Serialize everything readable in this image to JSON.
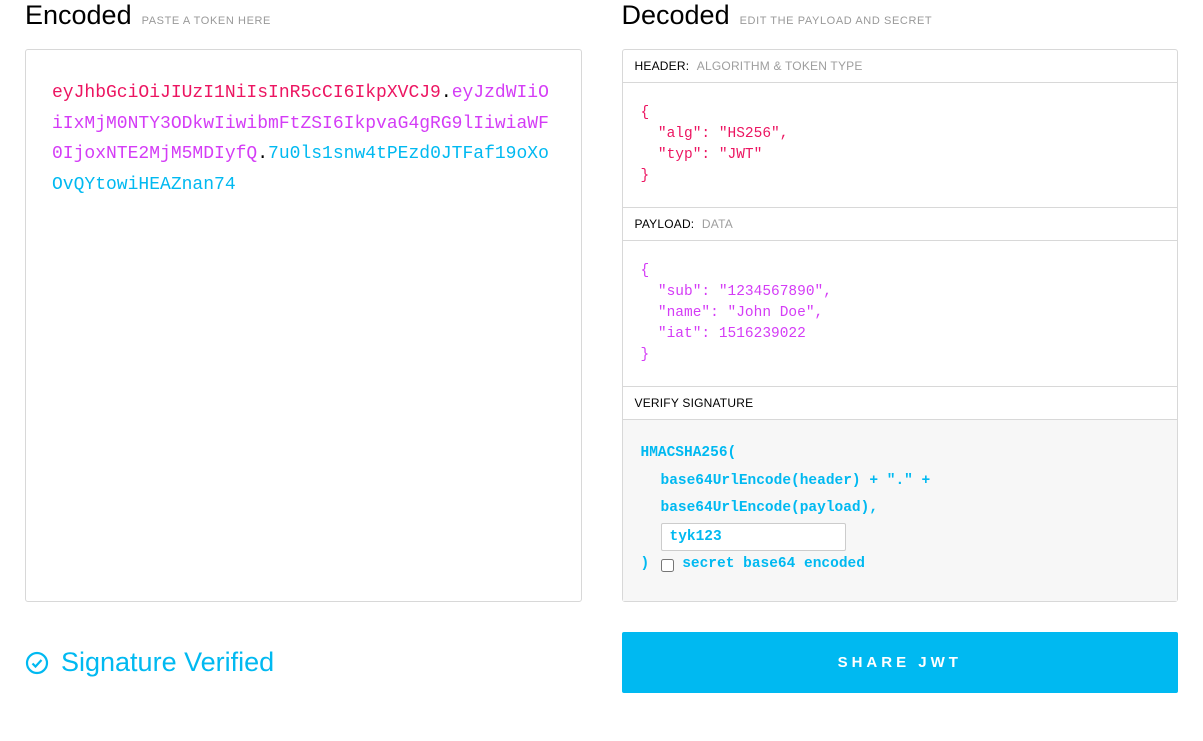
{
  "encoded": {
    "title": "Encoded",
    "hint": "PASTE A TOKEN HERE",
    "token": {
      "header": "eyJhbGciOiJIUzI1NiIsInR5cCI6IkpXVCJ9",
      "payload": "eyJzdWIiOiIxMjM0NTY3ODkwIiwibmFtZSI6IkpvaG4gRG9lIiwiaWF0IjoxNTE2MjM5MDIyfQ",
      "signature": "7u0ls1snw4tPEzd0JTFaf19oXoOvQYtowiHEAZnan74"
    }
  },
  "decoded": {
    "title": "Decoded",
    "hint": "EDIT THE PAYLOAD AND SECRET",
    "header_section": {
      "label": "HEADER:",
      "sub": "ALGORITHM & TOKEN TYPE",
      "content": "{\n  \"alg\": \"HS256\",\n  \"typ\": \"JWT\"\n}"
    },
    "payload_section": {
      "label": "PAYLOAD:",
      "sub": "DATA",
      "content": "{\n  \"sub\": \"1234567890\",\n  \"name\": \"John Doe\",\n  \"iat\": 1516239022\n}"
    },
    "signature_section": {
      "label": "VERIFY SIGNATURE",
      "line1": "HMACSHA256(",
      "line2": "base64UrlEncode(header) + \".\" +",
      "line3": "base64UrlEncode(payload),",
      "secret_value": "tyk123",
      "closing": ")",
      "checkbox_label": "secret base64 encoded"
    }
  },
  "status": {
    "verified_text": "Signature Verified"
  },
  "share": {
    "label": "SHARE JWT"
  }
}
